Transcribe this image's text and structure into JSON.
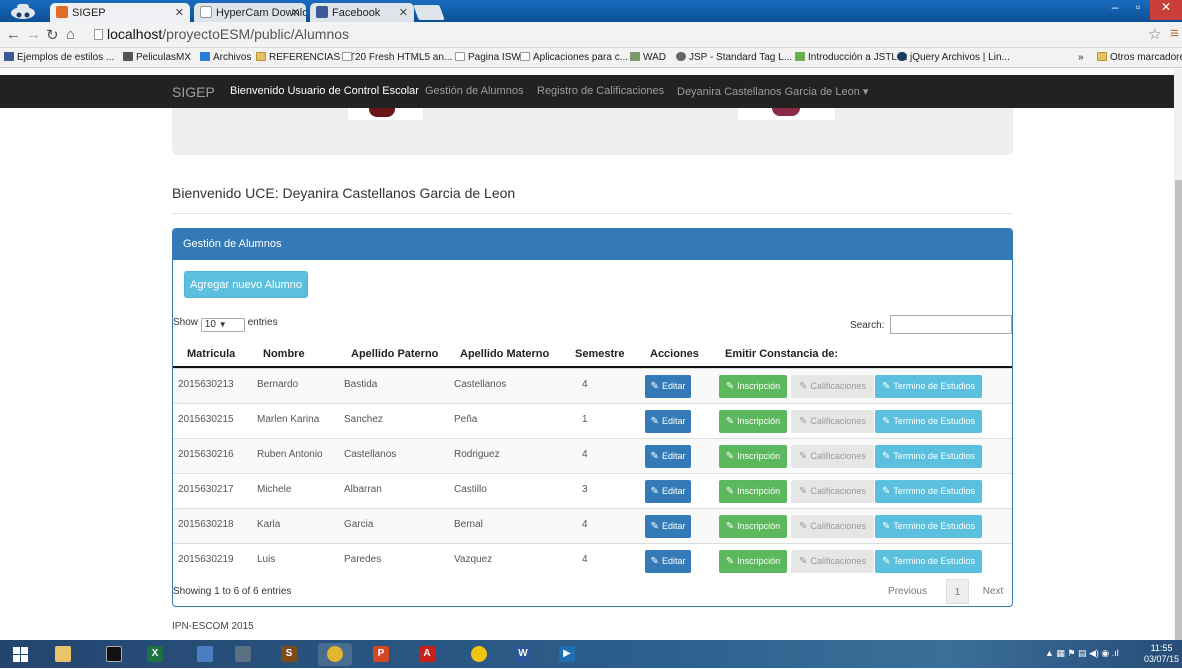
{
  "browser": {
    "tabs": [
      {
        "title": "SIGEP"
      },
      {
        "title": "HyperCam Downloads"
      },
      {
        "title": "Facebook"
      }
    ],
    "url_host": "localhost",
    "url_path": "/proyectoESM/public/Alumnos",
    "bookmarks": [
      "Ejemplos de estilos ...",
      "PeliculasMX",
      "Archivos",
      "REFERENCIAS TT",
      "20 Fresh HTML5 an...",
      "Pagina ISW",
      "Aplicaciones para c...",
      "WAD",
      "JSP - Standard Tag L...",
      "Introducción a JSTL ...",
      "jQuery Archivos | Lin...",
      "»",
      "Otros marcadores"
    ]
  },
  "nav": {
    "brand": "SIGEP",
    "links": [
      "Bienvenido Usuario de Control Escolar",
      "Gestión de Alumnos",
      "Registro de Calificaciones",
      "Deyanira Castellanos Garcia de Leon ▾"
    ]
  },
  "welcome": "Bienvenido UCE: Deyanira Castellanos Garcia de Leon",
  "panel": {
    "title": "Gestión de Alumnos",
    "add_button": "Agregar nuevo Alumno",
    "show_label": "Show",
    "entries_value": "10",
    "entries_label": "entries",
    "search_label": "Search:",
    "headers": [
      "Matricula",
      "Nombre",
      "Apellido Paterno",
      "Apellido Materno",
      "Semestre",
      "Acciones",
      "Emitir Constancia de:"
    ],
    "rows": [
      {
        "matricula": "2015630213",
        "nombre": "Bernardo",
        "paterno": "Bastida",
        "materno": "Castellanos",
        "semestre": "4"
      },
      {
        "matricula": "2015630215",
        "nombre": "Marlen Karina",
        "paterno": "Sanchez",
        "materno": "Peña",
        "semestre": "1"
      },
      {
        "matricula": "2015630216",
        "nombre": "Ruben Antonio",
        "paterno": "Castellanos",
        "materno": "Rodriguez",
        "semestre": "4"
      },
      {
        "matricula": "2015630217",
        "nombre": "Michele",
        "paterno": "Albarran",
        "materno": "Castillo",
        "semestre": "3"
      },
      {
        "matricula": "2015630218",
        "nombre": "Karla",
        "paterno": "Garcia",
        "materno": "Bernal",
        "semestre": "4"
      },
      {
        "matricula": "2015630219",
        "nombre": "Luis",
        "paterno": "Paredes",
        "materno": "Vazquez",
        "semestre": "4"
      }
    ],
    "btn_edit": "Editar",
    "btn_inscripcion": "Inscripción",
    "btn_calificaciones": "Calificaciones",
    "btn_termino": "Termino de Estudios",
    "info": "Showing 1 to 6 of 6 entries",
    "prev": "Previous",
    "page": "1",
    "next": "Next"
  },
  "footer": "IPN-ESCOM 2015",
  "taskbar": {
    "time": "11:55",
    "date": "03/07/15"
  },
  "colors": {
    "primary": "#337ab7",
    "success": "#5cb85c",
    "info": "#5bc0de",
    "navbar": "#222222"
  }
}
